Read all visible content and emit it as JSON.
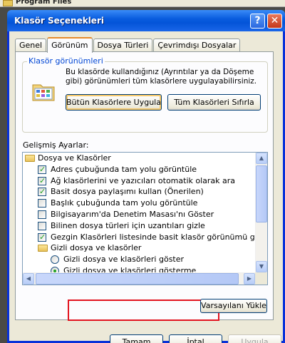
{
  "background": {
    "partial_label": "Program Files"
  },
  "window": {
    "title": "Klasör Seçenekleri",
    "help_glyph": "?",
    "close_glyph": "✕"
  },
  "tabs": [
    {
      "label": "Genel",
      "active": false
    },
    {
      "label": "Görünüm",
      "active": true
    },
    {
      "label": "Dosya Türleri",
      "active": false
    },
    {
      "label": "Çevrimdışı Dosyalar",
      "active": false
    }
  ],
  "folder_views": {
    "legend": "Klasör görünümleri",
    "description": "Bu klasörde kullandığınız (Ayrıntılar ya da Döşeme gibi) görünümleri tüm klasörlere uygulayabilirsiniz.",
    "apply_all_label": "Bütün Klasörlere Uygula",
    "reset_all_label": "Tüm Klasörleri Sıfırla"
  },
  "advanced": {
    "label": "Gelişmiş Ayarlar:",
    "items": [
      {
        "type": "folder",
        "indent": 0,
        "label": "Dosya ve Klasörler"
      },
      {
        "type": "checkbox",
        "indent": 1,
        "checked": true,
        "label": "Adres çubuğunda tam yolu görüntüle"
      },
      {
        "type": "checkbox",
        "indent": 1,
        "checked": true,
        "label": "Ağ klasörlerini ve yazıcıları otomatik olarak ara"
      },
      {
        "type": "checkbox",
        "indent": 1,
        "checked": true,
        "label": "Basit dosya paylaşımı kullan (Önerilen)"
      },
      {
        "type": "checkbox",
        "indent": 1,
        "checked": false,
        "label": "Başlık çubuğunda tam yolu görüntüle"
      },
      {
        "type": "checkbox",
        "indent": 1,
        "checked": false,
        "label": "Bilgisayarım'da Denetim Masası'nı Göster"
      },
      {
        "type": "checkbox",
        "indent": 1,
        "checked": false,
        "label": "Bilinen dosya türleri için uzantıları gizle"
      },
      {
        "type": "checkbox",
        "indent": 1,
        "checked": true,
        "label": "Gezgin Klasörleri listesinde basit klasör görünümü görüntü"
      },
      {
        "type": "folder",
        "indent": 1,
        "label": "Gizli dosya ve klasörler"
      },
      {
        "type": "radio",
        "indent": 2,
        "checked": false,
        "label": "Gizli dosya ve klasörleri göster"
      },
      {
        "type": "radio",
        "indent": 2,
        "checked": true,
        "label": "Gizli dosya ve klasörleri gösterme"
      }
    ]
  },
  "defaults_label": "Varsayılanı Yükle",
  "footer": {
    "ok_label": "Tamam",
    "cancel_label": "İptal",
    "apply_label": "Uygula"
  }
}
